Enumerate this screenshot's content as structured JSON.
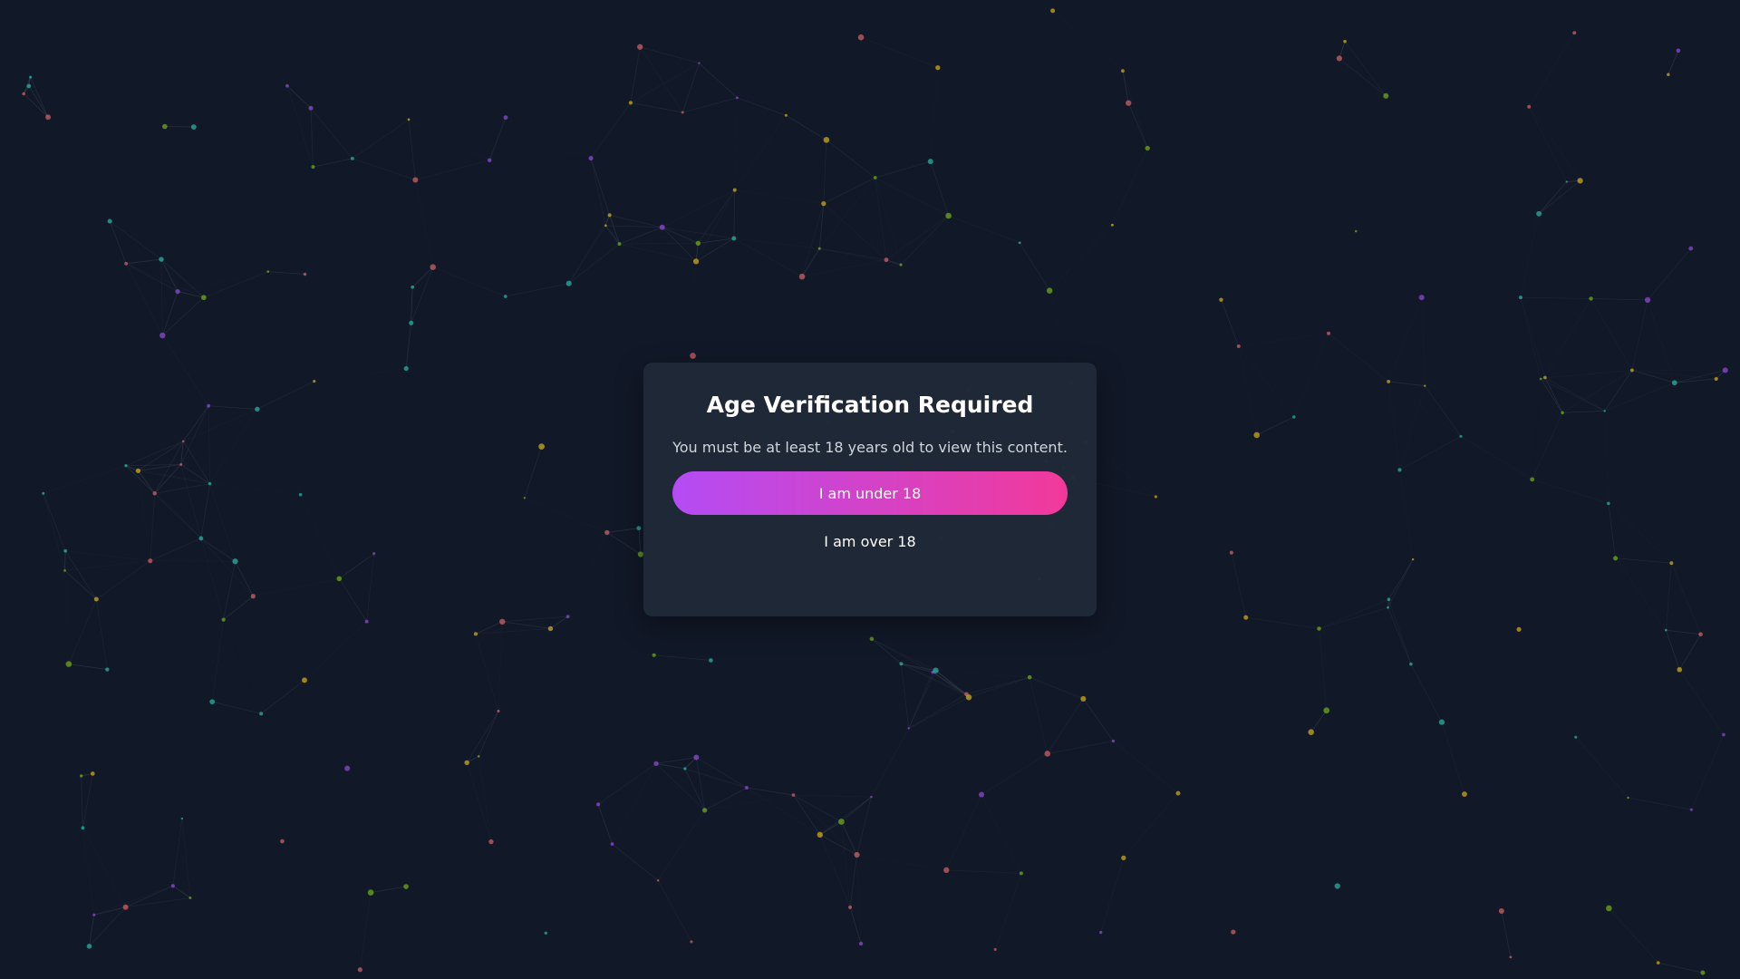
{
  "modal": {
    "title": "Age Verification Required",
    "message": "You must be at least 18 years old to view this content.",
    "under_button_label": "I am under 18",
    "over_button_label": "I am over 18"
  },
  "colors": {
    "background": "#111827",
    "modal_background": "#1f2937",
    "gradient_start": "#b44cf5",
    "gradient_end": "#f2399a",
    "node_colors": [
      "#2dd4bf",
      "#f87171",
      "#facc15",
      "#a855f7",
      "#84cc16"
    ],
    "line_color": "#4b5563"
  }
}
